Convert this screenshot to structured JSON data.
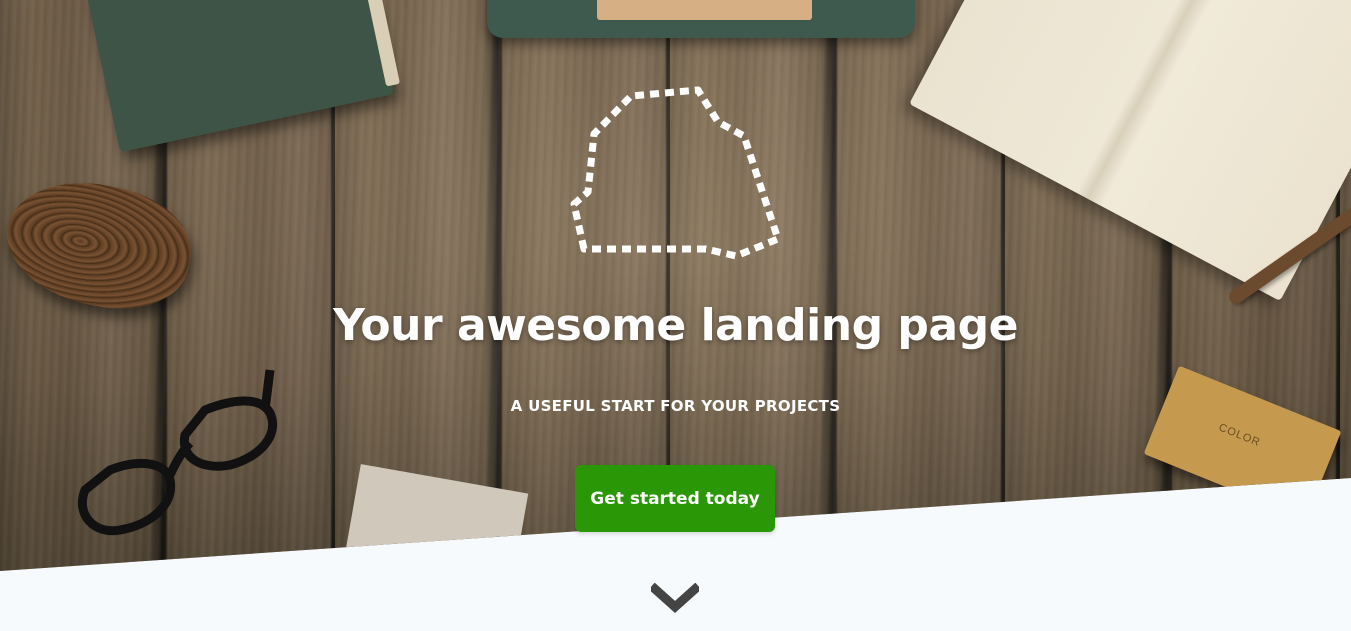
{
  "hero": {
    "title": "Your awesome landing page",
    "subtitle": "A USEFUL START FOR YOUR PROJECTS",
    "cta_label": "Get started today",
    "box_label": "COLOR",
    "logo_icon": "dashed-outline-logo-icon",
    "scroll_icon": "chevron-down-icon"
  },
  "colors": {
    "cta_background": "#2a9707",
    "title_text": "#ffffff",
    "section_background": "#f7fafd",
    "chevron": "#444444"
  }
}
